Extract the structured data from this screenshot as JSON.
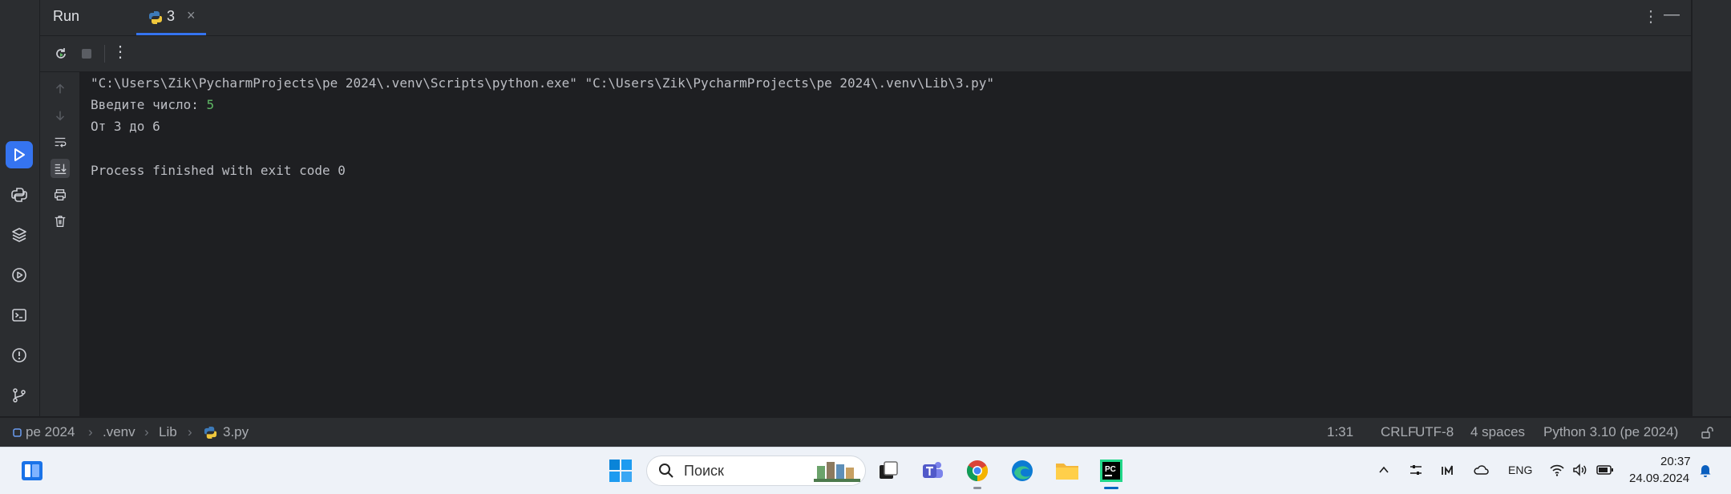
{
  "header": {
    "panel_title": "Run",
    "tab_label": "3",
    "tab_close": "×",
    "more_glyph": "⋮",
    "minimize_glyph": "—"
  },
  "toolbar": {
    "more_glyph": "⋮"
  },
  "console": {
    "command_line": "\"C:\\Users\\Zik\\PycharmProjects\\pe 2024\\.venv\\Scripts\\python.exe\" \"C:\\Users\\Zik\\PycharmProjects\\pe 2024\\.venv\\Lib\\3.py\"",
    "prompt": "Введите число: ",
    "user_input": "5",
    "result": "От 3 до 6",
    "exit_message": "Process finished with exit code 0"
  },
  "statusbar": {
    "breadcrumbs": [
      "pe 2024",
      ".venv",
      "Lib",
      "3.py"
    ],
    "position": "1:31",
    "line_separator": "CRLF",
    "encoding": "UTF-8",
    "indent": "4 spaces",
    "interpreter": "Python 3.10 (pe 2024)"
  },
  "taskbar": {
    "search_placeholder": "Поиск",
    "language": "ENG",
    "time": "20:37",
    "date": "24.09.2024"
  },
  "colors": {
    "accent": "#3574f0",
    "console_input": "#5fb865",
    "background": "#1e1f22",
    "panel": "#2b2d30"
  }
}
